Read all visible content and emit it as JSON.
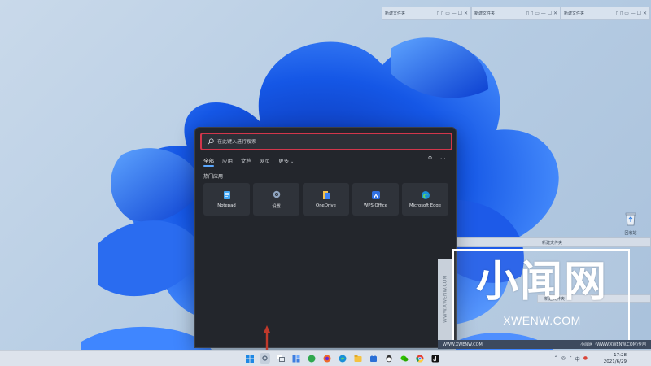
{
  "mini_windows": [
    {
      "title": "新建文件夹"
    },
    {
      "title": "新建文件夹"
    },
    {
      "title": "新建文件夹"
    }
  ],
  "search": {
    "placeholder": "在此键入进行搜索"
  },
  "tabs": [
    {
      "label": "全部",
      "active": true
    },
    {
      "label": "应用",
      "active": false
    },
    {
      "label": "文档",
      "active": false
    },
    {
      "label": "网页",
      "active": false
    },
    {
      "label": "更多",
      "active": false,
      "dropdown": true
    }
  ],
  "section": {
    "label": "热门应用"
  },
  "apps": [
    {
      "name": "Notepad",
      "icon": "notepad-icon"
    },
    {
      "name": "设置",
      "icon": "settings-gear-icon"
    },
    {
      "name": "OneDrive",
      "icon": "onedrive-icon"
    },
    {
      "name": "WPS Office",
      "icon": "wps-office-icon"
    },
    {
      "name": "Microsoft Edge",
      "icon": "edge-icon"
    }
  ],
  "side_windows": [
    {
      "title": "新建文件夹"
    },
    {
      "title": "新建文件夹"
    }
  ],
  "recycle_bin": {
    "label": "回收站"
  },
  "watermark": {
    "big": "小闻网",
    "sub": "XWENW.COM",
    "vertical": "WWW.XWENW.COM",
    "strip_left": "WWW.XWENW.COM",
    "strip_right": "小闻网（WWW.XWENW.COM)专用"
  },
  "clock": {
    "time": "17:28",
    "date": "2021/6/29"
  },
  "colors": {
    "panel_bg": "#23262c",
    "search_border": "#d2364b",
    "tab_indicator": "#5aa7ff",
    "taskbar_bg": "#dde3ec"
  }
}
